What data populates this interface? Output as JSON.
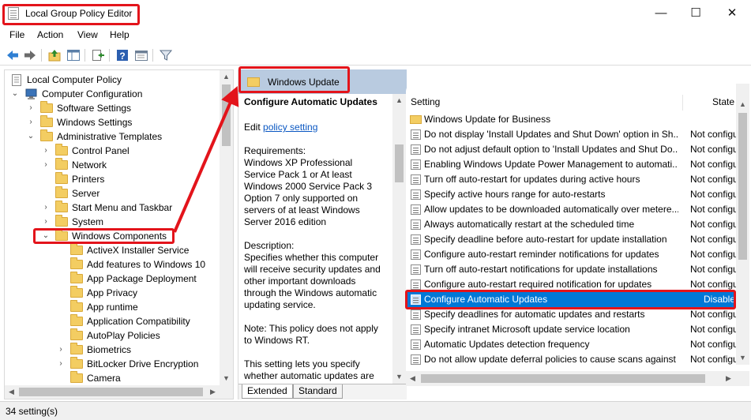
{
  "window": {
    "title": "Local Group Policy Editor",
    "controls": {
      "minimize": "—",
      "maximize": "☐",
      "close": "✕"
    }
  },
  "menu": [
    "File",
    "Action",
    "View",
    "Help"
  ],
  "toolbar": [
    "back-icon",
    "forward-icon",
    "up-folder-icon",
    "show-hide-tree-icon",
    "export-list-icon",
    "help-icon",
    "properties-icon",
    "filter-icon"
  ],
  "tree": {
    "items": [
      {
        "label": "Local Computer Policy",
        "icon": "policy-icon",
        "expander": ""
      },
      {
        "label": "Computer Configuration",
        "icon": "computer-icon",
        "expander": "⌄"
      },
      {
        "label": "Software Settings",
        "icon": "folder-icon",
        "expander": "›"
      },
      {
        "label": "Windows Settings",
        "icon": "folder-icon",
        "expander": "›"
      },
      {
        "label": "Administrative Templates",
        "icon": "folder-icon",
        "expander": "⌄"
      },
      {
        "label": "Control Panel",
        "icon": "folder-icon",
        "expander": "›"
      },
      {
        "label": "Network",
        "icon": "folder-icon",
        "expander": "›"
      },
      {
        "label": "Printers",
        "icon": "folder-icon",
        "expander": ""
      },
      {
        "label": "Server",
        "icon": "folder-icon",
        "expander": ""
      },
      {
        "label": "Start Menu and Taskbar",
        "icon": "folder-icon",
        "expander": "›"
      },
      {
        "label": "System",
        "icon": "folder-icon",
        "expander": "›"
      },
      {
        "label": "Windows Components",
        "icon": "folder-icon",
        "expander": "⌄"
      },
      {
        "label": "ActiveX Installer Service",
        "icon": "folder-icon",
        "expander": ""
      },
      {
        "label": "Add features to Windows 10",
        "icon": "folder-icon",
        "expander": ""
      },
      {
        "label": "App Package Deployment",
        "icon": "folder-icon",
        "expander": ""
      },
      {
        "label": "App Privacy",
        "icon": "folder-icon",
        "expander": ""
      },
      {
        "label": "App runtime",
        "icon": "folder-icon",
        "expander": ""
      },
      {
        "label": "Application Compatibility",
        "icon": "folder-icon",
        "expander": ""
      },
      {
        "label": "AutoPlay Policies",
        "icon": "folder-icon",
        "expander": ""
      },
      {
        "label": "Biometrics",
        "icon": "folder-icon",
        "expander": "›"
      },
      {
        "label": "BitLocker Drive Encryption",
        "icon": "folder-icon",
        "expander": "›"
      },
      {
        "label": "Camera",
        "icon": "folder-icon",
        "expander": ""
      }
    ]
  },
  "middle": {
    "header": "Windows Update",
    "policy_title": "Configure Automatic Updates",
    "edit_prefix": "Edit ",
    "edit_link": "policy setting",
    "requirements_label": "Requirements:",
    "requirements": "Windows XP Professional Service Pack 1 or At least Windows 2000 Service Pack 3 Option 7 only supported on servers of at least Windows Server 2016 edition",
    "description_label": "Description:",
    "description": "Specifies whether this computer will receive security updates and other important downloads through the Windows automatic updating service.",
    "note": "Note: This policy does not apply to Windows RT.",
    "extra": "This setting lets you specify whether automatic updates are enabled on this computer. If the",
    "tabs": [
      "Extended",
      "Standard"
    ]
  },
  "list": {
    "columns": {
      "setting": "Setting",
      "state": "State"
    },
    "rows": [
      {
        "name": "Windows Update for Business",
        "state": "",
        "type": "folder"
      },
      {
        "name": "Do not display 'Install Updates and Shut Down' option in Sh...",
        "state": "Not configured",
        "type": "policy"
      },
      {
        "name": "Do not adjust default option to 'Install Updates and Shut Do...",
        "state": "Not configured",
        "type": "policy"
      },
      {
        "name": "Enabling Windows Update Power Management to automati...",
        "state": "Not configured",
        "type": "policy"
      },
      {
        "name": "Turn off auto-restart for updates during active hours",
        "state": "Not configured",
        "type": "policy"
      },
      {
        "name": "Specify active hours range for auto-restarts",
        "state": "Not configured",
        "type": "policy"
      },
      {
        "name": "Allow updates to be downloaded automatically over metere...",
        "state": "Not configured",
        "type": "policy"
      },
      {
        "name": "Always automatically restart at the scheduled time",
        "state": "Not configured",
        "type": "policy"
      },
      {
        "name": "Specify deadline before auto-restart for update installation",
        "state": "Not configured",
        "type": "policy"
      },
      {
        "name": "Configure auto-restart reminder notifications for updates",
        "state": "Not configured",
        "type": "policy"
      },
      {
        "name": "Turn off auto-restart notifications for update installations",
        "state": "Not configured",
        "type": "policy"
      },
      {
        "name": "Configure auto-restart required notification for updates",
        "state": "Not configured",
        "type": "policy"
      },
      {
        "name": "Configure Automatic Updates",
        "state": "Disabled",
        "type": "policy",
        "selected": true
      },
      {
        "name": "Specify deadlines for automatic updates and restarts",
        "state": "Not configured",
        "type": "policy"
      },
      {
        "name": "Specify intranet Microsoft update service location",
        "state": "Not configured",
        "type": "policy"
      },
      {
        "name": "Automatic Updates detection frequency",
        "state": "Not configured",
        "type": "policy"
      },
      {
        "name": "Do not allow update deferral policies to cause scans against ...",
        "state": "Not configured",
        "type": "policy"
      }
    ]
  },
  "status": "34 setting(s)",
  "colors": {
    "highlight": "#e3141b",
    "selection": "#0078d7",
    "header": "#b9cbe0",
    "link": "#0a57c2"
  }
}
